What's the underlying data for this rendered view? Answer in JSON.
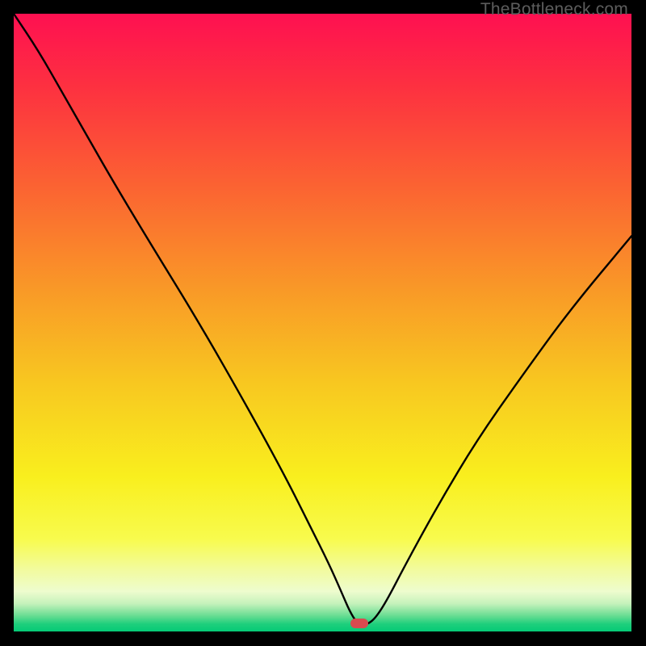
{
  "watermark": "TheBottleneck.com",
  "colors": {
    "marker": "#d94a4f",
    "curve_stroke": "#000000",
    "gradient_stops": [
      {
        "pct": 0,
        "color": "#fe1051"
      },
      {
        "pct": 12,
        "color": "#fd3140"
      },
      {
        "pct": 28,
        "color": "#fb6332"
      },
      {
        "pct": 45,
        "color": "#f99a27"
      },
      {
        "pct": 60,
        "color": "#f8c820"
      },
      {
        "pct": 75,
        "color": "#f9ef1e"
      },
      {
        "pct": 85,
        "color": "#f8fb4d"
      },
      {
        "pct": 90,
        "color": "#f2fb9e"
      },
      {
        "pct": 93.5,
        "color": "#eefcce"
      },
      {
        "pct": 95.5,
        "color": "#c5f2bb"
      },
      {
        "pct": 97.4,
        "color": "#6bdd93"
      },
      {
        "pct": 98.8,
        "color": "#1ecf7c"
      },
      {
        "pct": 100,
        "color": "#05ca76"
      }
    ]
  },
  "chart_data": {
    "type": "line",
    "title": "",
    "xlabel": "",
    "ylabel": "",
    "xlim": [
      0,
      100
    ],
    "ylim": [
      0,
      100
    ],
    "series": [
      {
        "name": "bottleneck-curve",
        "x": [
          0,
          4,
          8,
          12,
          16,
          22,
          30,
          38,
          44,
          48,
          51,
          53,
          54.5,
          55.8,
          57.2,
          58.6,
          60.5,
          63.5,
          69,
          75,
          82,
          90,
          100
        ],
        "y": [
          100,
          94,
          87,
          80,
          73,
          63,
          50,
          36,
          25,
          17,
          11,
          6.5,
          3.0,
          1.1,
          1.1,
          2.2,
          5.2,
          11,
          21,
          31,
          41,
          52,
          64
        ]
      }
    ],
    "marker": {
      "x": 56.0,
      "y": 1.3
    },
    "annotations": []
  }
}
